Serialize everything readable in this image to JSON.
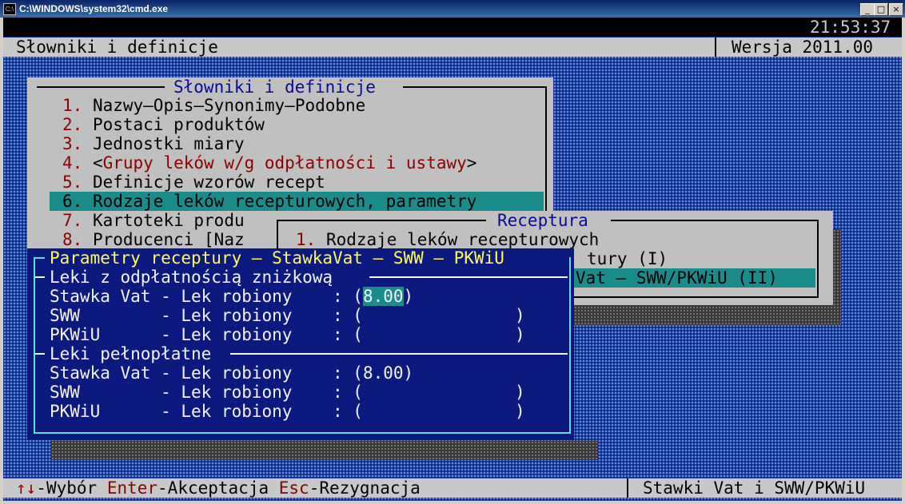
{
  "window": {
    "title": "C:\\WINDOWS\\system32\\cmd.exe",
    "min": "_",
    "max": "□",
    "close": "×",
    "icon": "C:\\"
  },
  "header": {
    "clock": "21:53:37",
    "title": "Słowniki i definicje",
    "version": "Wersja 2011.00"
  },
  "menu1": {
    "title": "Słowniki i definicje",
    "items": [
      {
        "num": "1.",
        "label": "Nazwy—Opis—Synonimy—Podobne"
      },
      {
        "num": "2.",
        "label": "Postaci produktów"
      },
      {
        "num": "3.",
        "label": "Jednostki miary"
      },
      {
        "num": "4.",
        "pre": "<",
        "label": "Grupy leków w/g odpłatności i ustawy",
        "post": ">"
      },
      {
        "num": "5.",
        "label": "Definicje wzorów recept"
      },
      {
        "num": "6.",
        "label": "Rodzaje leków recepturowych, parametry"
      },
      {
        "num": "7.",
        "label": "Kartoteki produ"
      },
      {
        "num": "8.",
        "label": "Producenci [Naz"
      }
    ]
  },
  "menu2": {
    "title": "Receptura",
    "items": [
      {
        "num": "1.",
        "label": "Rodzaje leków recepturowych"
      },
      {
        "label": "tury (I)"
      },
      {
        "label": "Vat — SWW/PKWiU (II)"
      }
    ]
  },
  "dialog": {
    "title": "Parametry receptury — StawkaVat — SWW — PKWiU",
    "sec1": {
      "heading": "Leki z odpłatnością zniżkową",
      "rows": [
        {
          "label": "Stawka Vat - Lek robiony",
          "sep": ": (",
          "value": "8.00",
          "close": ")"
        },
        {
          "label": "SWW        - Lek robiony",
          "sep": ": (",
          "value": "",
          "close": ")"
        },
        {
          "label": "PKWiU      - Lek robiony",
          "sep": ": (",
          "value": "",
          "close": ")"
        }
      ]
    },
    "sec2": {
      "heading": "Leki pełnopłatne",
      "rows": [
        {
          "label": "Stawka Vat - Lek robiony",
          "sep": ": (",
          "value": "8.00",
          "close": ")"
        },
        {
          "label": "SWW        - Lek robiony",
          "sep": ": (",
          "value": "",
          "close": ")"
        },
        {
          "label": "PKWiU      - Lek robiony",
          "sep": ": (",
          "value": "",
          "close": ")"
        }
      ]
    }
  },
  "footer": {
    "arrows_key": "↑↓",
    "arrows_action": "-Wybór",
    "enter_key": "Enter",
    "enter_action": "-Akceptacja",
    "esc_key": "Esc",
    "esc_action": "-Rezygnacja",
    "context": "Stawki Vat i SWW/PKWiU"
  },
  "colors": {
    "background": "#1c44a6",
    "dialog": "#0c1a80",
    "highlight": "#1a8c8c",
    "hotkey": "#8a0000",
    "dialog_title": "#ffff55"
  }
}
